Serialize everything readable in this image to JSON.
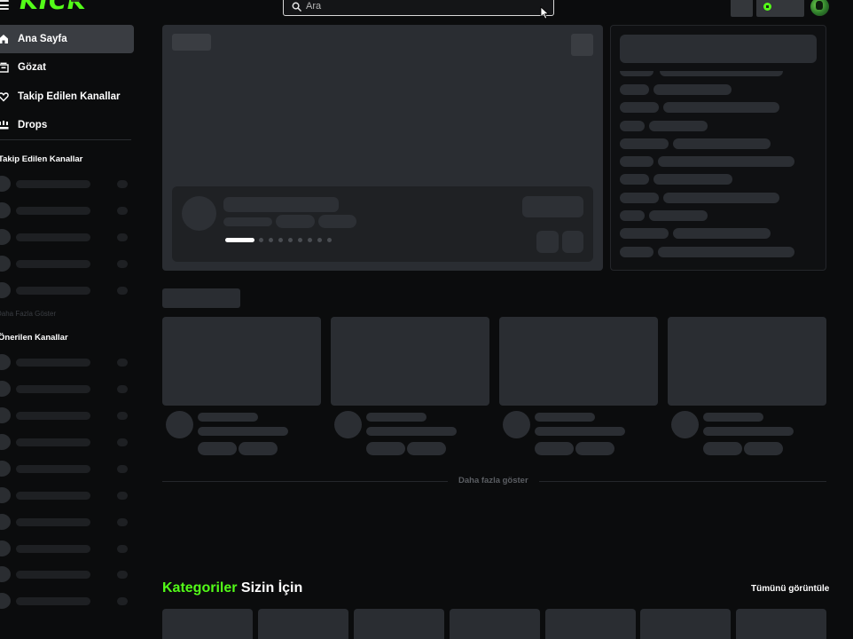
{
  "brand": {
    "logo_text": "KICK",
    "accent_color": "#53fc18"
  },
  "search": {
    "placeholder": "Ara"
  },
  "sidebar": {
    "nav": [
      {
        "label": "Ana Sayfa",
        "icon": "home-icon",
        "active": true
      },
      {
        "label": "Gözat",
        "icon": "browse-icon",
        "active": false
      },
      {
        "label": "Takip Edilen Kanallar",
        "icon": "heart-icon",
        "active": false
      },
      {
        "label": "Drops",
        "icon": "drops-icon",
        "active": false
      }
    ],
    "followed_title": "Takip Edilen Kanallar",
    "show_more_followed": "Daha Fazla Göster",
    "recommended_title": "Önerilen Kanallar"
  },
  "main": {
    "show_more": "Daha fazla göster",
    "categories": {
      "title_accent": "Kategoriler",
      "title_rest": " Sizin İçin",
      "view_all": "Tümünü görüntüle"
    }
  },
  "colors": {
    "background": "#0b0c0d",
    "skeleton": "#2b2e33",
    "active_nav": "#3a3d42"
  }
}
